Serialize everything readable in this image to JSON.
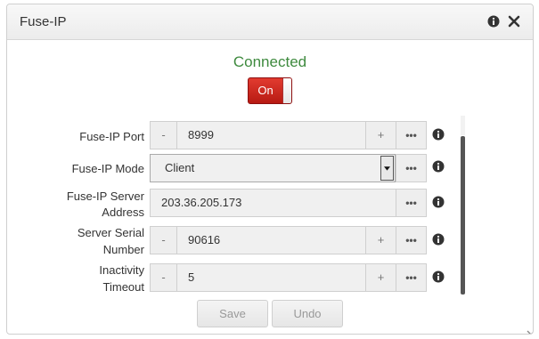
{
  "panel": {
    "title": "Fuse-IP"
  },
  "status": {
    "text": "Connected",
    "color": "#3e8a3e"
  },
  "power_toggle": {
    "label": "On",
    "state": "on",
    "color": "#c9231a"
  },
  "fields": {
    "port": {
      "label": "Fuse-IP Port",
      "value": "8999",
      "minus": "-",
      "plus": "+",
      "more": "•••"
    },
    "mode": {
      "label": "Fuse-IP Mode",
      "value": "Client",
      "more": "•••"
    },
    "server_address": {
      "label_line1": "Fuse-IP Server",
      "label_line2": "Address",
      "value": "203.36.205.173",
      "more": "•••"
    },
    "serial": {
      "label_line1": "Server Serial",
      "label_line2": "Number",
      "value": "90616",
      "minus": "-",
      "plus": "+",
      "more": "•••"
    },
    "inactivity": {
      "label_line1": "Inactivity",
      "label_line2": "Timeout",
      "value": "5",
      "minus": "-",
      "plus": "+",
      "more": "•••"
    }
  },
  "buttons": {
    "save": "Save",
    "undo": "Undo"
  },
  "icons": {
    "info": "info-icon",
    "close": "close-icon",
    "dropdown": "chevron-down-icon"
  }
}
